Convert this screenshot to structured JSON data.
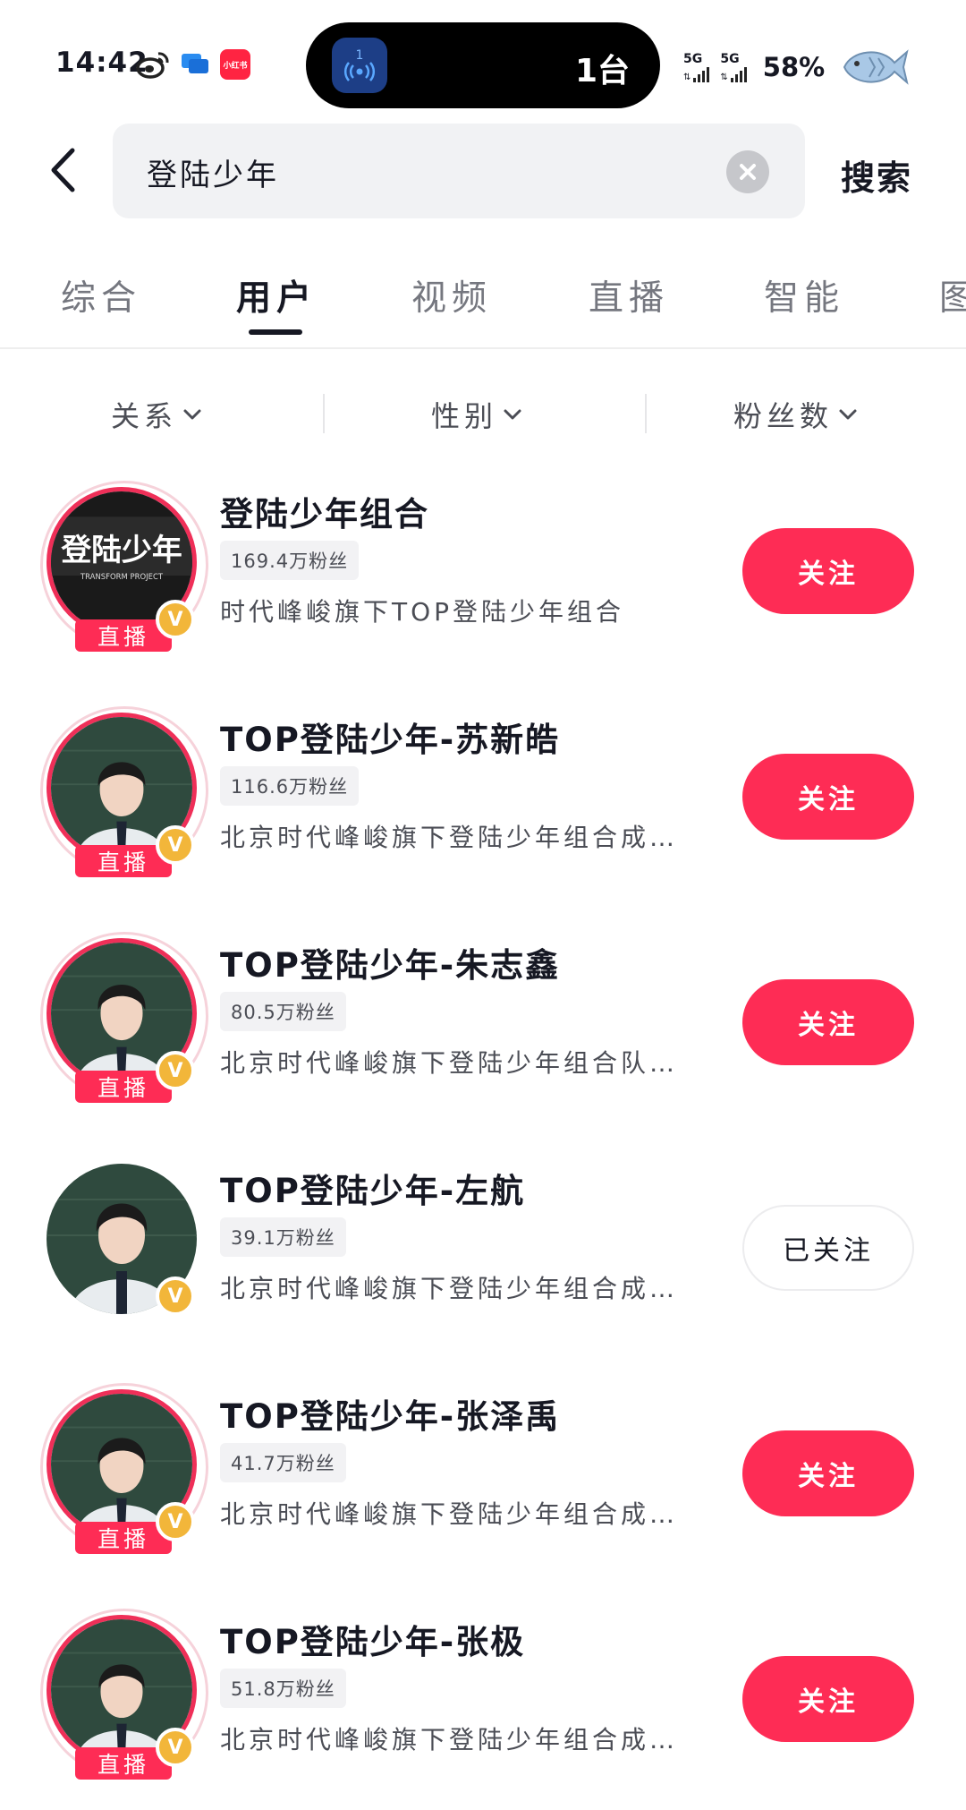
{
  "status_bar": {
    "time": "14:42",
    "island_app_badge": "1",
    "island_count": "1台",
    "network_1": "5G",
    "network_2": "5G",
    "battery": "58%",
    "xhs_icon_text": "小红书"
  },
  "search": {
    "query": "登陆少年",
    "button_label": "搜索"
  },
  "tabs": [
    {
      "label": "综合",
      "active": false
    },
    {
      "label": "用户",
      "active": true
    },
    {
      "label": "视频",
      "active": false
    },
    {
      "label": "直播",
      "active": false
    },
    {
      "label": "智能",
      "active": false
    },
    {
      "label": "图",
      "active": false
    }
  ],
  "filters": [
    {
      "label": "关系"
    },
    {
      "label": "性别"
    },
    {
      "label": "粉丝数"
    }
  ],
  "users": [
    {
      "name": "登陆少年组合",
      "fans": "169.4万粉丝",
      "desc": "时代峰峻旗下TOP登陆少年组合",
      "live": true,
      "live_label": "直播",
      "verified": true,
      "follow_label": "关注",
      "followed": false,
      "avatar_text": "登陆少年",
      "avatar_sub": "TRANSFORM PROJECT"
    },
    {
      "name": "TOP登陆少年-苏新皓",
      "fans": "116.6万粉丝",
      "desc": "北京时代峰峻旗下登陆少年组合成…",
      "live": true,
      "live_label": "直播",
      "verified": true,
      "follow_label": "关注",
      "followed": false
    },
    {
      "name": "TOP登陆少年-朱志鑫",
      "fans": "80.5万粉丝",
      "desc": "北京时代峰峻旗下登陆少年组合队…",
      "live": true,
      "live_label": "直播",
      "verified": true,
      "follow_label": "关注",
      "followed": false
    },
    {
      "name": "TOP登陆少年-左航",
      "fans": "39.1万粉丝",
      "desc": "北京时代峰峻旗下登陆少年组合成…",
      "live": false,
      "live_label": "",
      "verified": true,
      "follow_label": "已关注",
      "followed": true
    },
    {
      "name": "TOP登陆少年-张泽禹",
      "fans": "41.7万粉丝",
      "desc": "北京时代峰峻旗下登陆少年组合成…",
      "live": true,
      "live_label": "直播",
      "verified": true,
      "follow_label": "关注",
      "followed": false
    },
    {
      "name": "TOP登陆少年-张极",
      "fans": "51.8万粉丝",
      "desc": "北京时代峰峻旗下登陆少年组合成…",
      "live": true,
      "live_label": "直播",
      "verified": true,
      "follow_label": "关注",
      "followed": false
    }
  ],
  "colors": {
    "accent": "#fe2c55",
    "verified": "#f2b63a",
    "search_bg": "#f1f2f4"
  },
  "icons": {
    "back": "back-arrow-icon",
    "clear": "clear-icon",
    "chevron": "chevron-down-icon",
    "verified": "verified-icon",
    "weibo": "weibo-icon",
    "message": "message-icon",
    "fish": "fish-icon"
  }
}
